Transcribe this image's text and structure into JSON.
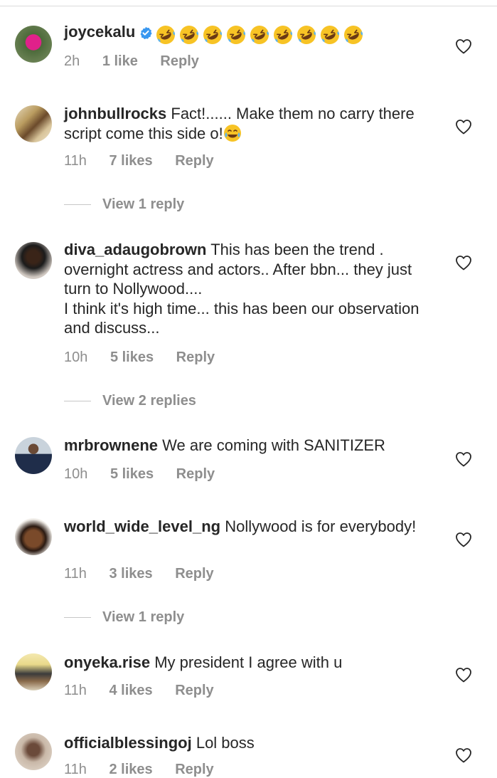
{
  "comments": [
    {
      "username": "joycekalu",
      "verified": true,
      "text": "",
      "emoji_count": 9,
      "time": "2h",
      "likes": "1 like",
      "reply": "Reply"
    },
    {
      "username": "johnbullrocks",
      "text": "Fact!...... Make them no carry there script come this side o!",
      "time": "11h",
      "likes": "7 likes",
      "reply": "Reply",
      "view_replies": "View 1 reply"
    },
    {
      "username": "diva_adaugobrown",
      "text": "This has been the trend . overnight actress and actors.. After bbn... they just turn to Nollywood....",
      "text2": "I think it's high time... this has been our observation and discuss...",
      "time": "10h",
      "likes": "5 likes",
      "reply": "Reply",
      "view_replies": "View 2 replies"
    },
    {
      "username": "mrbrownene",
      "text": "We are coming with SANITIZER",
      "time": "10h",
      "likes": "5 likes",
      "reply": "Reply"
    },
    {
      "username": "world_wide_level_ng",
      "text": "Nollywood is for everybody!",
      "time": "11h",
      "likes": "3 likes",
      "reply": "Reply",
      "view_replies": "View 1 reply"
    },
    {
      "username": "onyeka.rise",
      "text": "My president I agree with u",
      "time": "11h",
      "likes": "4 likes",
      "reply": "Reply"
    },
    {
      "username": "officialblessingoj",
      "text": "Lol boss",
      "time": "11h",
      "likes": "2 likes",
      "reply": "Reply"
    }
  ],
  "icons": {
    "like": "heart-outline-icon",
    "verified": "verified-badge-icon",
    "emoji": "rolling-on-floor-laughing-emoji",
    "emoji_tears": "face-with-tears-of-joy-emoji"
  },
  "colors": {
    "text": "#262626",
    "secondary": "#8e8e8e",
    "verified": "#3897f0",
    "emoji": "#f7c325"
  }
}
